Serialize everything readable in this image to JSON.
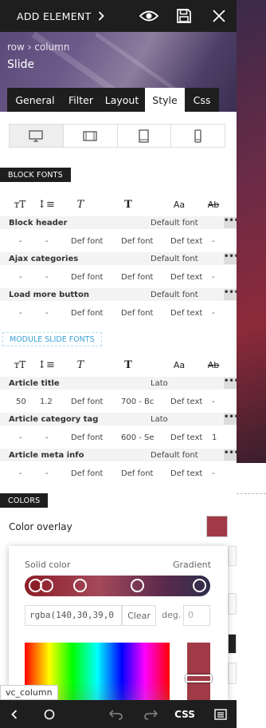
{
  "topbar": {
    "add_label": "ADD ELEMENT"
  },
  "header": {
    "breadcrumb": "row › column",
    "title": "Slide"
  },
  "tabs": [
    {
      "label": "General",
      "active": false
    },
    {
      "label": "Filter",
      "active": false
    },
    {
      "label": "Layout",
      "active": false
    },
    {
      "label": "Style",
      "active": true
    },
    {
      "label": "Css",
      "active": false
    }
  ],
  "devices": [
    "desktop-icon",
    "tablet-landscape-icon",
    "tablet-portrait-icon",
    "phone-icon"
  ],
  "block_fonts": {
    "title": "BLOCK FONTS",
    "icons": [
      "тT",
      "↕≡",
      "T",
      "T",
      "Aa",
      "A̵b"
    ],
    "rows": [
      {
        "label": "Block header",
        "font": "Default font",
        "values": [
          "-",
          "-",
          "Def font",
          "Def font",
          "Def text",
          "-"
        ]
      },
      {
        "label": "Ajax categories",
        "font": "Default font",
        "values": [
          "-",
          "-",
          "Def font",
          "Def font",
          "Def text",
          "-"
        ]
      },
      {
        "label": "Load more button",
        "font": "Default font",
        "values": [
          "-",
          "-",
          "Def font",
          "Def font",
          "Def text",
          "-"
        ]
      }
    ]
  },
  "module_fonts": {
    "title": "MODULE SLIDE FONTS",
    "rows": [
      {
        "label": "Article title",
        "font": "Lato",
        "values": [
          "50",
          "1.2",
          "Def font",
          "700 - Bc",
          "Def text",
          "-"
        ]
      },
      {
        "label": "Article category tag",
        "font": "Lato",
        "values": [
          "-",
          "-",
          "Def font",
          "600 - Se",
          "Def text",
          "1"
        ]
      },
      {
        "label": "Article meta info",
        "font": "Default font",
        "values": [
          "-",
          "-",
          "Def font",
          "Def font",
          "Def text",
          "-"
        ]
      }
    ]
  },
  "colors": {
    "title": "COLORS",
    "overlay_label": "Color overlay",
    "overlay_color": "#a13a47"
  },
  "picker": {
    "solid_label": "Solid color",
    "gradient_label": "Gradient",
    "rgba_value": "rgba(140,30,39,0",
    "clear_label": "Clear",
    "deg_label": "deg.",
    "deg_placeholder": "0"
  },
  "bottom": {
    "element_label": "vc_column",
    "css_label": "CSS"
  }
}
